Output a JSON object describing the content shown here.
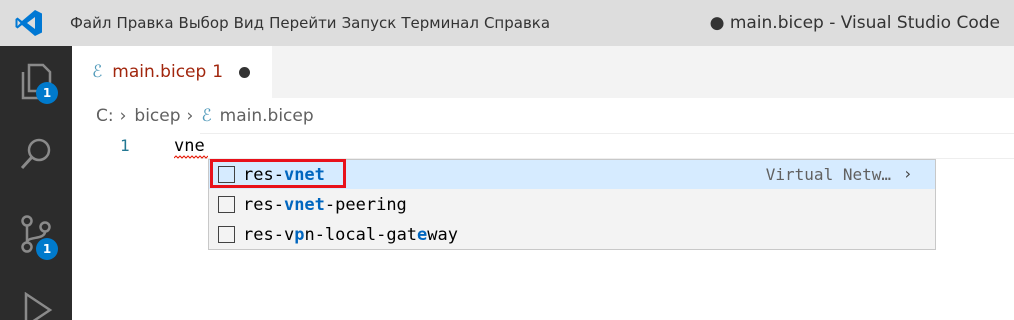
{
  "titlebar": {
    "menu": [
      "Файл",
      "Правка",
      "Выбор",
      "Вид",
      "Перейти",
      "Запуск",
      "Терминал",
      "Справка"
    ],
    "window_title": "● main.bicep - Visual Studio Code"
  },
  "activity_bar": {
    "explorer_badge": "1",
    "source_control_badge": "1"
  },
  "tab": {
    "name": "main.bicep",
    "problem_count": "1"
  },
  "breadcrumb": {
    "drive": "C:",
    "folder": "bicep",
    "file": "main.bicep"
  },
  "editor": {
    "line_number": "1",
    "code": "vne"
  },
  "suggestions": {
    "items": [
      {
        "prefix": "res-",
        "match": "vnet",
        "suffix": "",
        "detail": "Virtual Netw…"
      },
      {
        "prefix": "res-",
        "match": "vnet",
        "suffix": "-peering",
        "detail": ""
      },
      {
        "prefix": "res-v",
        "match2a": "p",
        "mid": "n",
        "rest": "-local-gat",
        "match2b": "e",
        "end": "way",
        "detail": ""
      }
    ],
    "chevron": "›"
  },
  "colors": {
    "accent": "#007acc",
    "highlight_box": "#e8111b",
    "match": "#0066bf",
    "tab_modified_text": "#a1260d"
  }
}
